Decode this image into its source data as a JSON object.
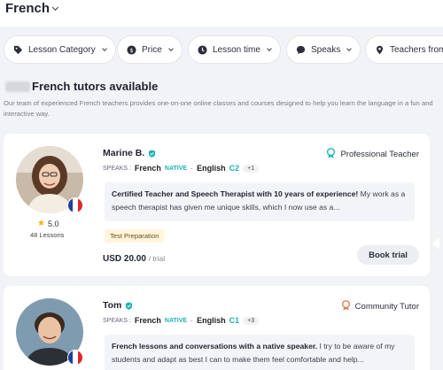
{
  "header": {
    "language": "French"
  },
  "filters": [
    {
      "label": "Lesson Category",
      "icon": "tag-icon"
    },
    {
      "label": "Price",
      "icon": "dollar-icon"
    },
    {
      "label": "Lesson time",
      "icon": "clock-icon"
    },
    {
      "label": "Speaks",
      "icon": "chat-icon"
    },
    {
      "label": "Teachers from",
      "icon": "location-icon"
    }
  ],
  "listing": {
    "heading": "French tutors available",
    "subtitle": "Our team of experienced French teachers provides one-on-one online classes and courses designed to help you learn the language in a fun and interactive way."
  },
  "tutors": [
    {
      "name": "Marine B.",
      "type": "Professional Teacher",
      "rating": "5.0",
      "lessons": "48 Lessons",
      "speaks_label": "SPEAKS :",
      "lang1": "French",
      "lang1_level": "NATIVE",
      "lang2": "English",
      "lang2_level": "C2",
      "more": "+1",
      "desc_bold": "Certified Teacher and Speech Therapist with 10 years of experience!",
      "desc_rest": " My work as a speech therapist has given me unique skills, which I now use as a...",
      "tag": "Test Preparation",
      "price": "USD 20.00",
      "price_unit": "/ trial",
      "cta": "Book trial"
    },
    {
      "name": "Tom",
      "type": "Community Tutor",
      "speaks_label": "SPEAKS :",
      "lang1": "French",
      "lang1_level": "NATIVE",
      "lang2": "English",
      "lang2_level": "C1",
      "more": "+3",
      "desc_bold": "French lessons and conversations with a native speaker.",
      "desc_rest": " I try to be aware of my students and adapt as best I can to make them feel comfortable and help..."
    }
  ],
  "colors": {
    "accent": "#1eb3b0",
    "star": "#f4b400",
    "tag_bg": "#fff5dd"
  }
}
